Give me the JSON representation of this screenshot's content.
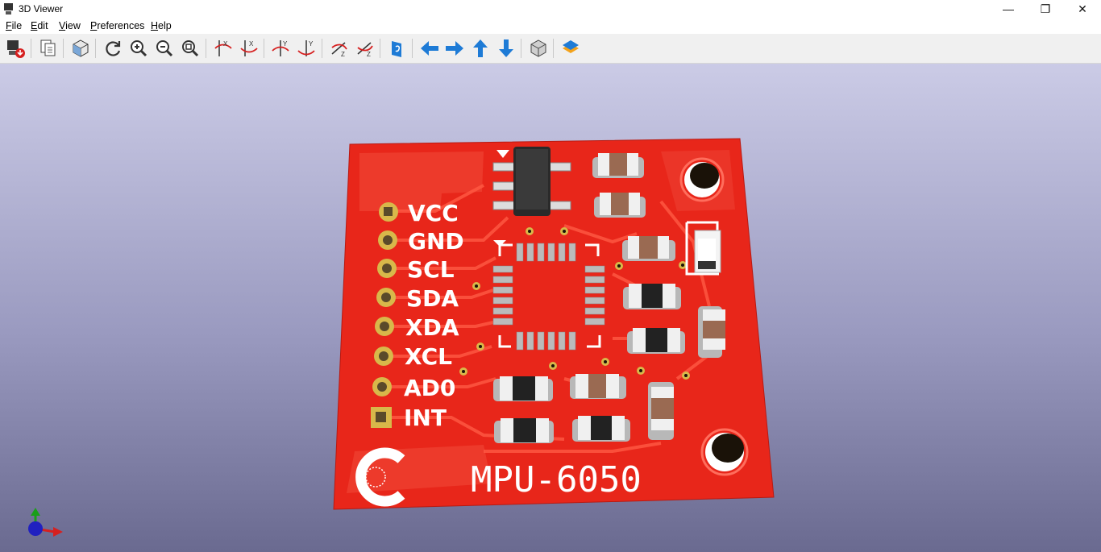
{
  "window": {
    "title": "3D Viewer",
    "controls": [
      "—",
      "❐",
      "✕"
    ]
  },
  "menu": [
    {
      "key": "F",
      "rest": "ile"
    },
    {
      "key": "E",
      "rest": "dit"
    },
    {
      "key": "V",
      "rest": "iew"
    },
    {
      "key": "P",
      "rest": "references"
    },
    {
      "key": "H",
      "rest": "elp"
    }
  ],
  "toolbar": {
    "icons": [
      "export-image-icon",
      "copy-image-icon",
      "render-options-icon",
      "reload-icon",
      "zoom-in-icon",
      "zoom-out-icon",
      "zoom-fit-icon",
      "rotate-x-cw-icon",
      "rotate-x-ccw-icon",
      "rotate-y-cw-icon",
      "rotate-y-ccw-icon",
      "rotate-z-cw-icon",
      "rotate-z-ccw-icon",
      "flip-board-icon",
      "pan-left-icon",
      "pan-right-icon",
      "pan-up-icon",
      "pan-down-icon",
      "toggle-projection-icon",
      "layers-icon"
    ],
    "accent_color": "#1e7bd6"
  },
  "board": {
    "pin_labels": [
      "VCC",
      "GND",
      "SCL",
      "SDA",
      "XDA",
      "XCL",
      "AD0",
      "INT"
    ],
    "silkscreen_title": "MPU-6050",
    "pcb_color": "#e8261a",
    "silk_color": "#ffffff"
  }
}
